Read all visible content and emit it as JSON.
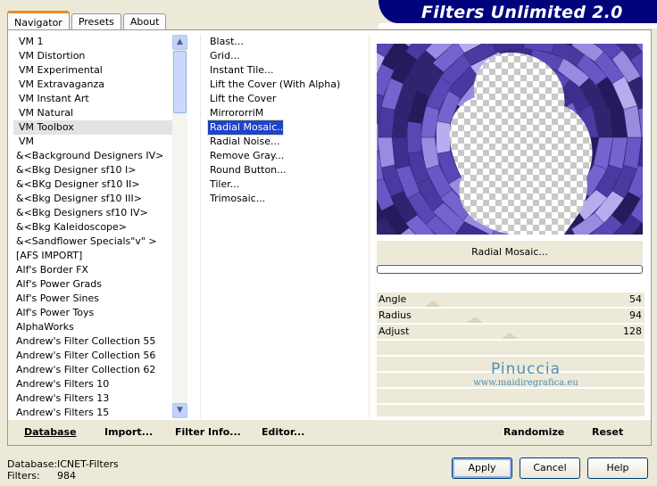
{
  "tabs": [
    "Navigator",
    "Presets",
    "About"
  ],
  "app_title": "Filters Unlimited 2.0",
  "categories": [
    "VM 1",
    "VM Distortion",
    "VM Experimental",
    "VM Extravaganza",
    "VM Instant Art",
    "VM Natural",
    "VM Toolbox",
    "VM",
    "&<Background Designers IV>",
    "&<Bkg Designer sf10 I>",
    "&<BKg Designer sf10 II>",
    "&<Bkg Designer sf10 III>",
    "&<Bkg Designers sf10 IV>",
    "&<Bkg Kaleidoscope>",
    "&<Sandflower Specials\"v\" >",
    "[AFS IMPORT]",
    "Alf's Border FX",
    "Alf's Power Grads",
    "Alf's Power Sines",
    "Alf's Power Toys",
    "AlphaWorks",
    "Andrew's Filter Collection 55",
    "Andrew's Filter Collection 56",
    "Andrew's Filter Collection 62",
    "Andrew's Filters 10",
    "Andrew's Filters 13",
    "Andrew's Filters 15"
  ],
  "selected_category": "VM Toolbox",
  "filters": [
    "Blast...",
    "Grid...",
    "Instant Tile...",
    "Lift the Cover (With Alpha)",
    "Lift the Cover",
    "MirrororriM",
    "Radial Mosaic...",
    "Radial Noise...",
    "Remove Gray...",
    "Round Button...",
    "Tiler...",
    "Trimosaic..."
  ],
  "selected_filter": "Radial Mosaic...",
  "filter_name_display": "Radial Mosaic...",
  "sliders": [
    {
      "label": "Angle",
      "value": "54"
    },
    {
      "label": "Radius",
      "value": "94"
    },
    {
      "label": "Adjust",
      "value": "128"
    }
  ],
  "watermark": {
    "name": "Pinuccia",
    "site": "www.maidiregrafica.eu"
  },
  "bottom_buttons": {
    "database": "Database",
    "import": "Import...",
    "filter_info": "Filter Info...",
    "editor": "Editor...",
    "randomize": "Randomize",
    "reset": "Reset"
  },
  "info": {
    "db_label": "Database:",
    "db_value": "ICNET-Filters",
    "filters_label": "Filters:",
    "filters_value": "984"
  },
  "dialog_buttons": {
    "apply": "Apply",
    "cancel": "Cancel",
    "help": "Help"
  },
  "colors": {
    "banner": "#00037c",
    "selection": "#1f43c9",
    "mosaic": "#5b46b6"
  }
}
